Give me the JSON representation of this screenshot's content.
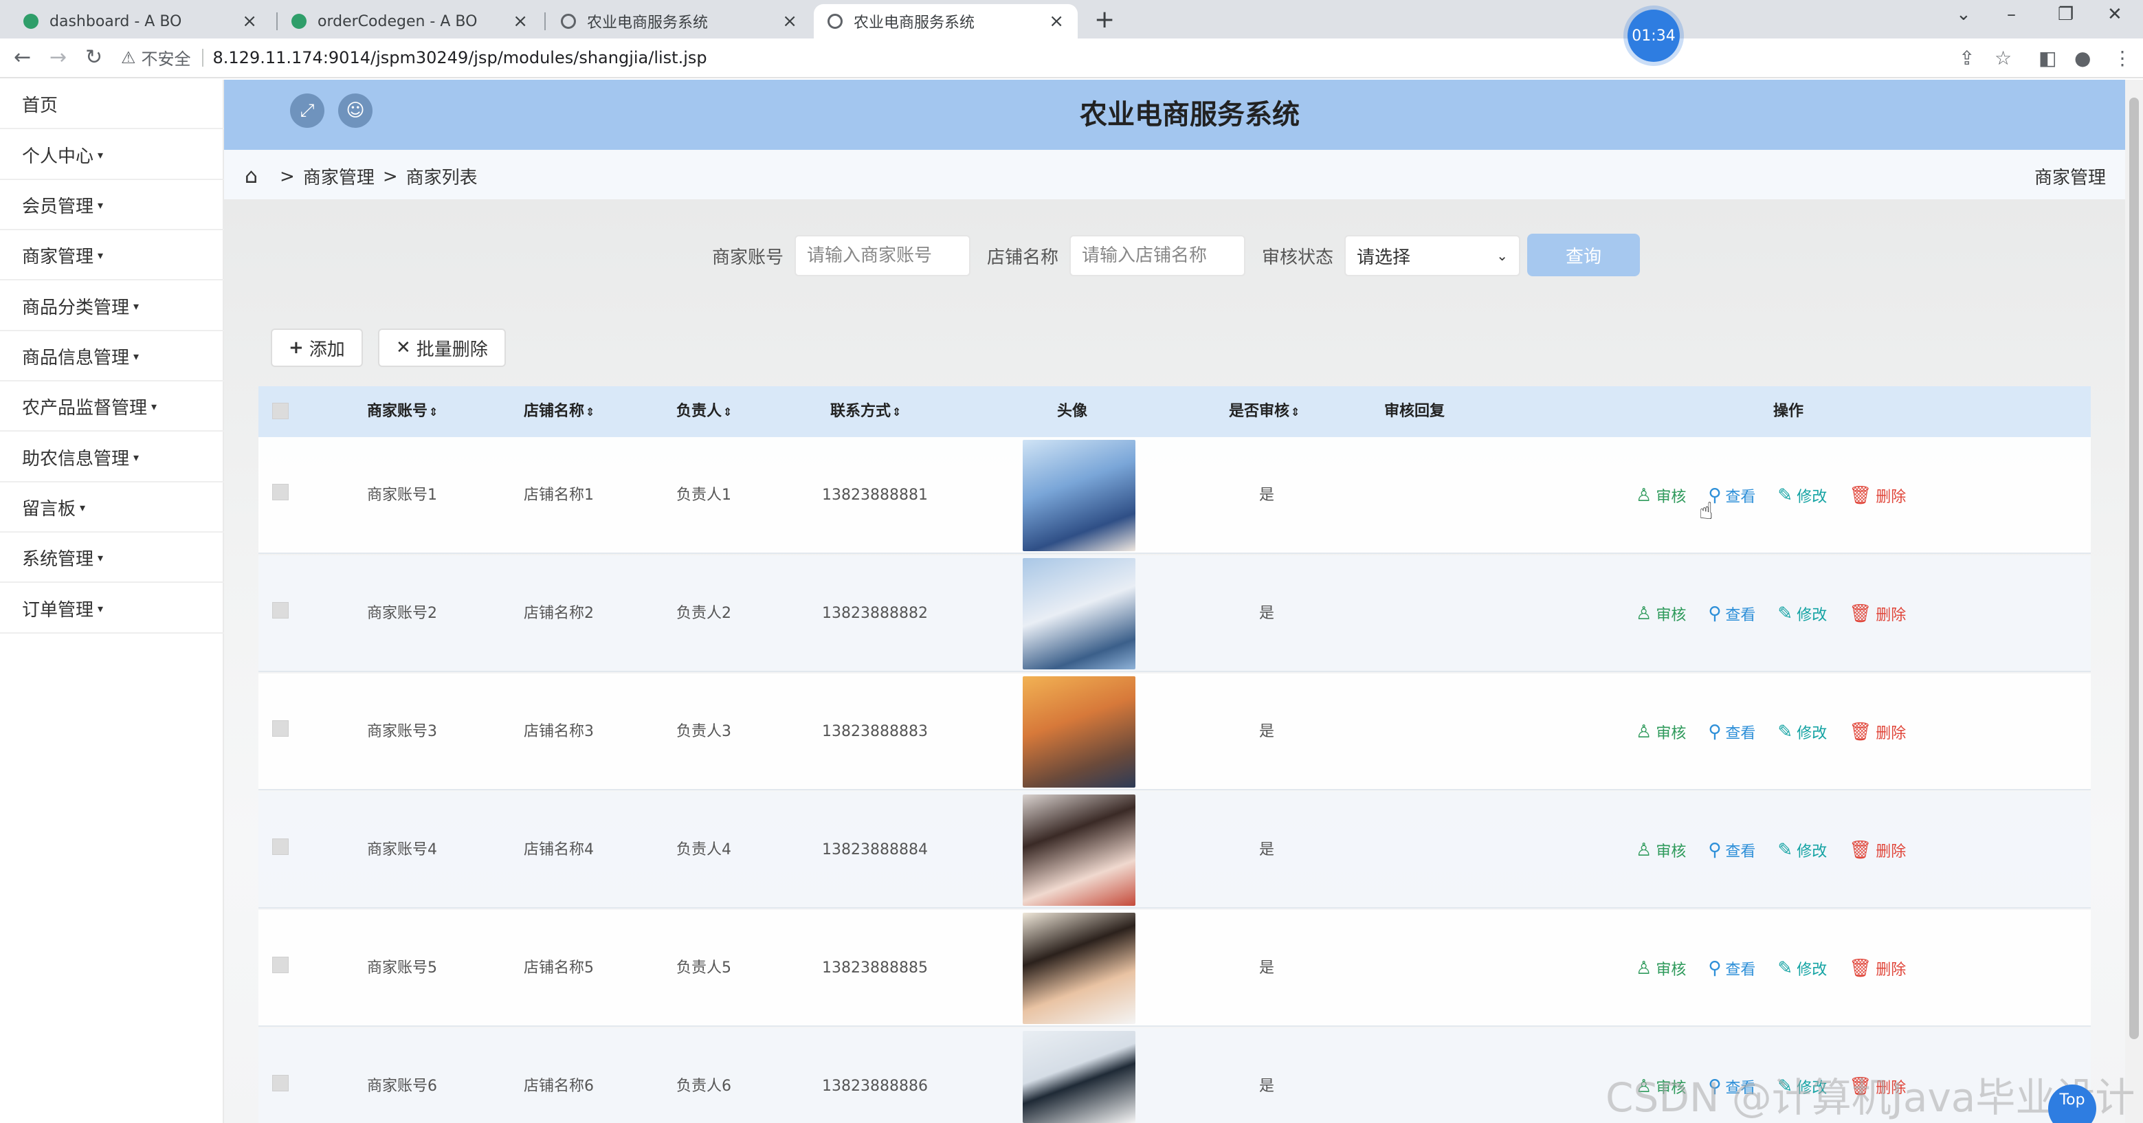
{
  "browser": {
    "tabs": [
      {
        "label": "dashboard - A BO",
        "icon": "leaf-icon"
      },
      {
        "label": "orderCodegen - A BO",
        "icon": "leaf-icon"
      },
      {
        "label": "农业电商服务系统",
        "icon": "globe-icon"
      },
      {
        "label": "农业电商服务系统",
        "icon": "shield-icon"
      }
    ],
    "timer": "01:34",
    "insecure_label": "不安全",
    "url": "8.129.11.174:9014/jspm30249/jsp/modules/shangjia/list.jsp"
  },
  "sidebar": {
    "items": [
      {
        "label": "首页",
        "caret": ""
      },
      {
        "label": "个人中心",
        "caret": "▾"
      },
      {
        "label": "会员管理",
        "caret": "▾"
      },
      {
        "label": "商家管理",
        "caret": "▾"
      },
      {
        "label": "商品分类管理",
        "caret": "▾"
      },
      {
        "label": "商品信息管理",
        "caret": "▾"
      },
      {
        "label": "农产品监督管理",
        "caret": "▾"
      },
      {
        "label": "助农信息管理",
        "caret": "▾"
      },
      {
        "label": "留言板",
        "caret": "▾"
      },
      {
        "label": "系统管理",
        "caret": "▾"
      },
      {
        "label": "订单管理",
        "caret": "▾"
      }
    ]
  },
  "header": {
    "title": "农业电商服务系统"
  },
  "breadcrumb": {
    "sep": ">",
    "level1": "商家管理",
    "level2": "商家列表",
    "right": "商家管理"
  },
  "search": {
    "account_label": "商家账号",
    "account_placeholder": "请输入商家账号",
    "shop_label": "店铺名称",
    "shop_placeholder": "请输入店铺名称",
    "status_label": "审核状态",
    "status_value": "请选择",
    "query_label": "查询"
  },
  "actions": {
    "add_label": "添加",
    "batch_delete_label": "批量删除"
  },
  "table": {
    "sort_glyph": "⇕",
    "headers": {
      "account": "商家账号",
      "shop": "店铺名称",
      "owner": "负责人",
      "phone": "联系方式",
      "avatar": "头像",
      "audited": "是否审核",
      "reply": "审核回复",
      "ops": "操作"
    },
    "op_labels": {
      "audit": "审核",
      "view": "查看",
      "edit": "修改",
      "delete": "删除"
    },
    "rows": [
      {
        "account": "商家账号1",
        "shop": "店铺名称1",
        "owner": "负责人1",
        "phone": "13823888881",
        "audited": "是",
        "reply": ""
      },
      {
        "account": "商家账号2",
        "shop": "店铺名称2",
        "owner": "负责人2",
        "phone": "13823888882",
        "audited": "是",
        "reply": ""
      },
      {
        "account": "商家账号3",
        "shop": "店铺名称3",
        "owner": "负责人3",
        "phone": "13823888883",
        "audited": "是",
        "reply": ""
      },
      {
        "account": "商家账号4",
        "shop": "店铺名称4",
        "owner": "负责人4",
        "phone": "13823888884",
        "audited": "是",
        "reply": ""
      },
      {
        "account": "商家账号5",
        "shop": "店铺名称5",
        "owner": "负责人5",
        "phone": "13823888885",
        "audited": "是",
        "reply": ""
      },
      {
        "account": "商家账号6",
        "shop": "店铺名称6",
        "owner": "负责人6",
        "phone": "13823888886",
        "audited": "是",
        "reply": ""
      }
    ]
  },
  "watermark": "CSDN @计算机Java毕业设计",
  "top_button": "Top"
}
